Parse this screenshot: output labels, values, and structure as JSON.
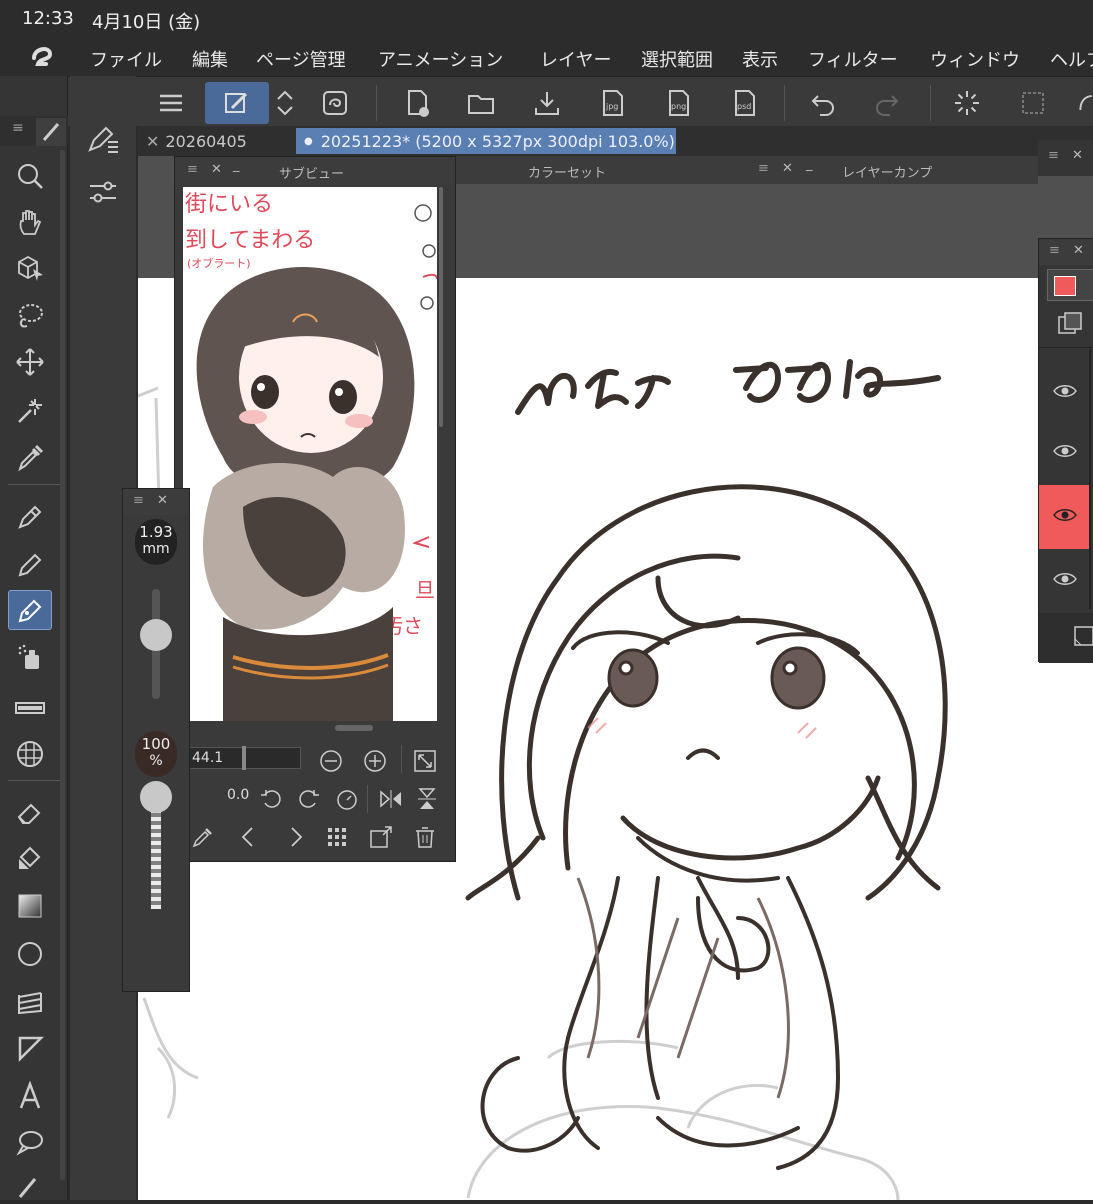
{
  "status": {
    "time": "12:33",
    "date": "4月10日 (金)"
  },
  "menu": {
    "items": [
      "ファイル",
      "編集",
      "ページ管理",
      "アニメーション",
      "レイヤー",
      "選択範囲",
      "表示",
      "フィルター",
      "ウィンドウ",
      "ヘルプ"
    ]
  },
  "tabs": [
    {
      "label": "20260405",
      "active": false
    },
    {
      "label": "20251223* (5200 x 5327px 300dpi 103.0%)",
      "active": true
    }
  ],
  "panels": {
    "subview": {
      "title": "サブビュー",
      "zoom_value": "44.1",
      "rotation_value": "0.0"
    },
    "colorset": {
      "title": "カラーセット"
    },
    "layercomp": {
      "title": "レイヤーカンプ"
    }
  },
  "brush": {
    "size_value": "1.93",
    "size_unit": "mm",
    "opacity_value": "100",
    "opacity_unit": "%"
  },
  "colors": {
    "accent_blue": "#4a6a9a",
    "active_tab": "#5a7fb3",
    "red_layer": "#f05a5a",
    "bg": "#2b2b2b"
  },
  "sketch": {
    "title_text": "ひだお ももね"
  },
  "subview_image": {
    "annotations": [
      "街にいる",
      "到してまわる",
      "(オブラート)",
      "旦",
      "汚さ"
    ]
  }
}
